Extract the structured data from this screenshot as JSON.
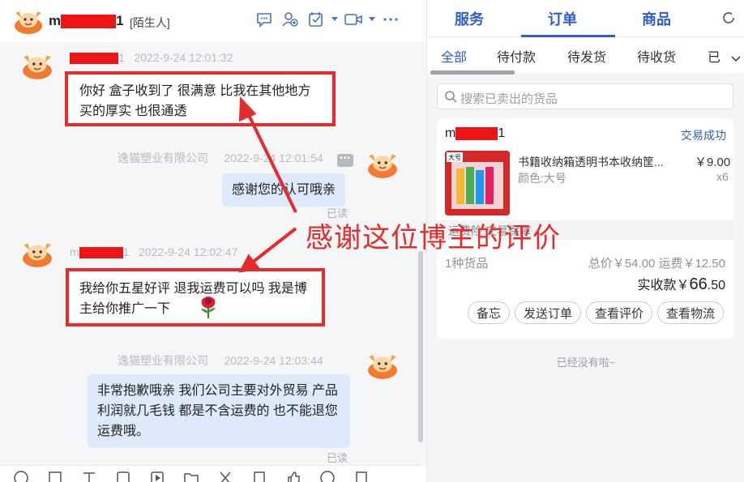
{
  "chat": {
    "header": {
      "name_prefix": "m",
      "name_suffix": "1",
      "tag": "[陌生人]"
    },
    "messages": [
      {
        "sender_prefix": "",
        "sender_suffix": "1",
        "time": "2022-9-24  12:01:32",
        "text": "你好 盒子收到了 很满意 比我在其他地方买的厚实 也很通透"
      },
      {
        "sender": "逸猫塑业有限公司",
        "time": "2022-9-24 12:01:54",
        "text": "感谢您的认可哦亲",
        "status": "已读"
      },
      {
        "sender_prefix": "m",
        "sender_suffix": "1",
        "time": "2022-9-24 12:02:47",
        "text": "我给你五星好评 退我运费可以吗 我是博主给你推广一下"
      },
      {
        "sender": "逸猫塑业有限公司",
        "time": "2022-9-24 12:03:44",
        "text": "非常抱歉哦亲 我们公司主要对外贸易 产品利润就几毛钱 都是不含运费的 也不能退您运费哦。",
        "status": "已读"
      }
    ],
    "annotation": "感谢这位博主的评价"
  },
  "side": {
    "tabs": [
      "服务",
      "订单",
      "商品"
    ],
    "filters": [
      "全部",
      "待付款",
      "待发货",
      "待收货",
      "已"
    ],
    "search_placeholder": "搜索已卖出的货品",
    "order": {
      "buyer_prefix": "m",
      "buyer_suffix": "1",
      "status": "交易成功",
      "product_title": "书籍收纳箱透明书本收纳筐...",
      "price": "￥9.00",
      "variant": "颜色:大号",
      "qty": "x6",
      "image_label": "大号",
      "service_text": "运费险  交易保障",
      "goods_count": "1种货品",
      "total": "总价￥54.00  运费￥12.50",
      "paid_label": "实收款￥",
      "paid_int": "66",
      "paid_dec": ".50",
      "buttons": [
        "备忘",
        "发送订单",
        "查看评价",
        "查看物流"
      ]
    },
    "no_more": "已经没有啦~"
  },
  "colors": {
    "accent": "#2f5ec4",
    "annotation_red": "#e52b2b",
    "out_bubble": "#deeafb"
  }
}
